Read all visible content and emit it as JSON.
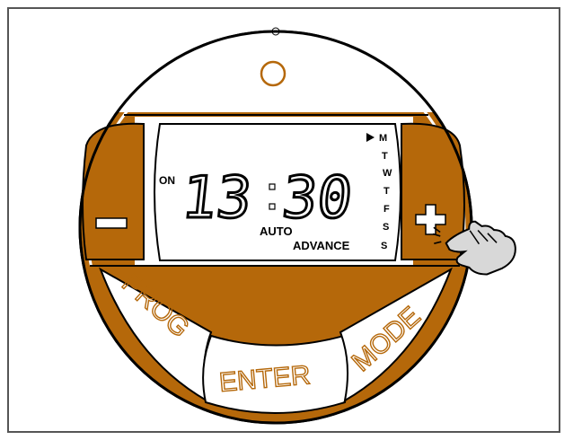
{
  "device": {
    "name": "Programmable timer controller",
    "accent": "#b5680a",
    "outline": "#000000",
    "lcd_bg": "#ffffff"
  },
  "lcd": {
    "time_hours": "13",
    "time_minutes": "30",
    "on_label": "ON",
    "auto_label": "AUTO",
    "advance_label": "ADVANCE",
    "days": [
      "M",
      "T",
      "W",
      "T",
      "F",
      "S",
      "S"
    ],
    "active_day_index": 0
  },
  "buttons": {
    "minus_label": "−",
    "plus_label": "+",
    "prog_label": "PROG",
    "enter_label": "ENTER",
    "mode_label": "MODE"
  },
  "icons": {
    "indicator": "circle-indicator-icon",
    "pointer": "hand-pointer-icon",
    "active_day_marker": "triangle-right-icon"
  }
}
